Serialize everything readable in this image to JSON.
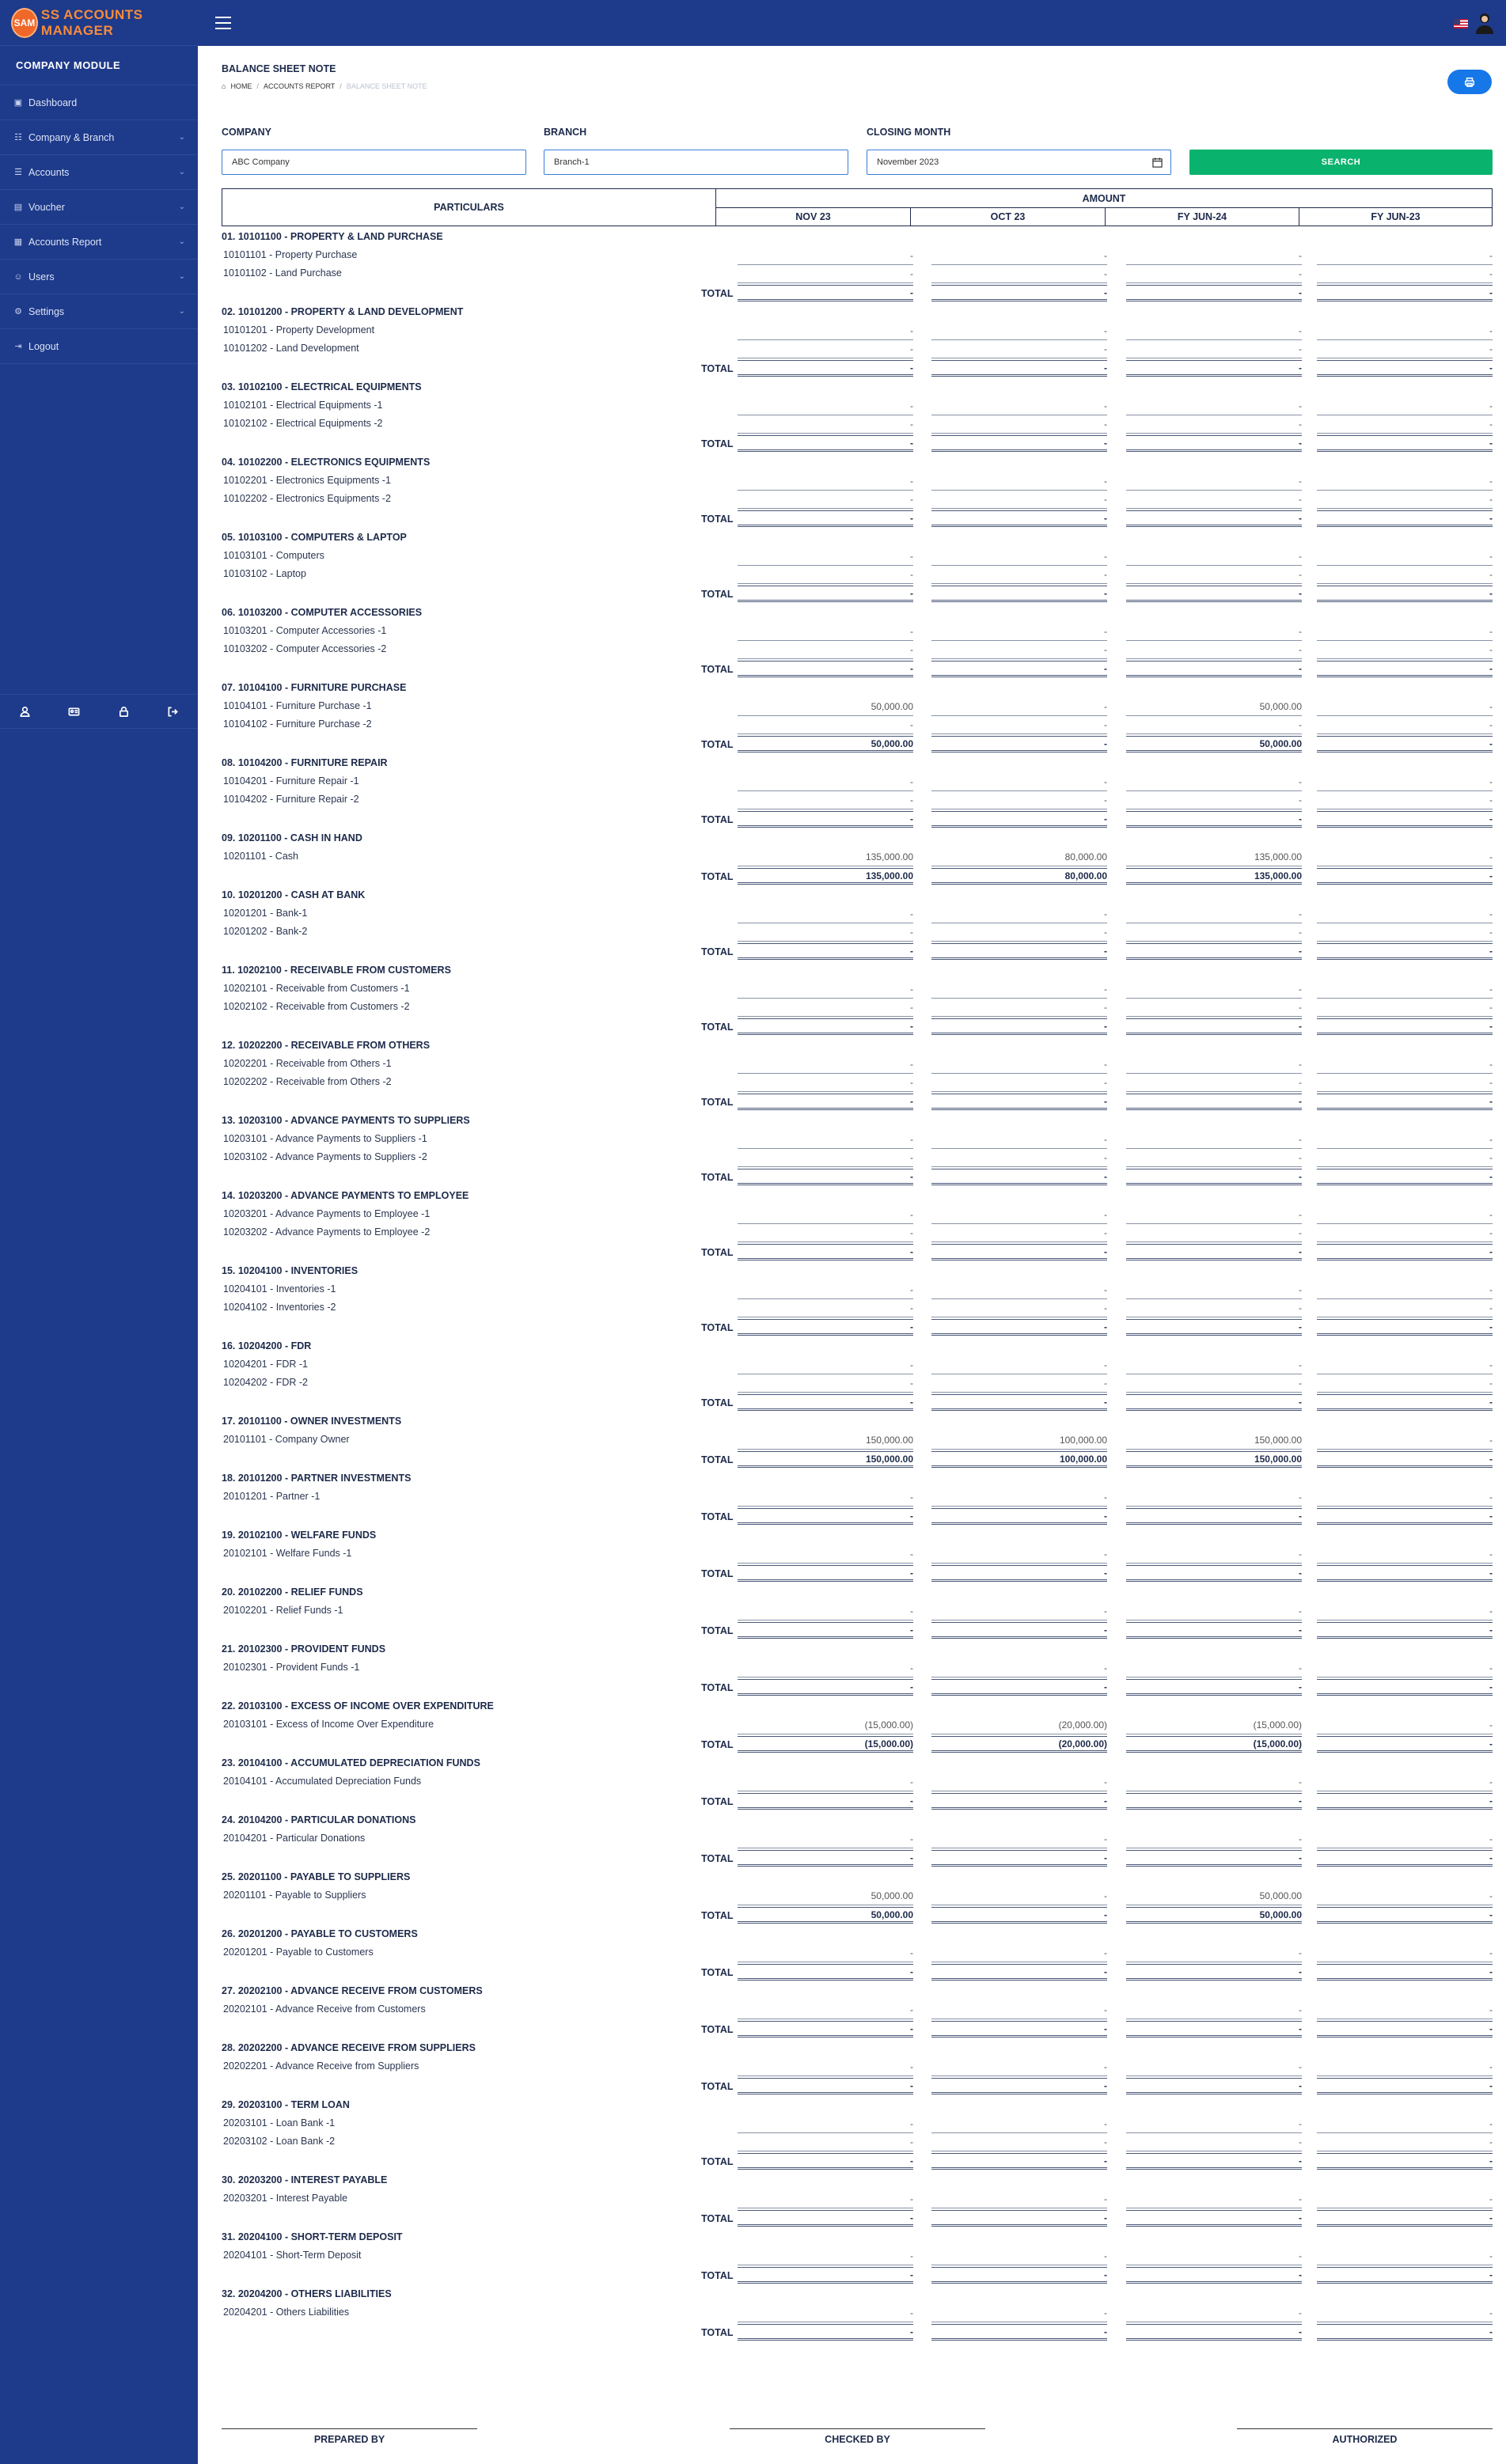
{
  "brand": {
    "logo_text": "SAM",
    "name": "SS ACCOUNTS MANAGER"
  },
  "sidebar": {
    "module_title": "COMPANY MODULE",
    "items": [
      {
        "label": "Dashboard",
        "icon": "home-icon",
        "has_children": false
      },
      {
        "label": "Company & Branch",
        "icon": "sitemap-icon",
        "has_children": true
      },
      {
        "label": "Accounts",
        "icon": "list-icon",
        "has_children": true
      },
      {
        "label": "Voucher",
        "icon": "file-icon",
        "has_children": true
      },
      {
        "label": "Accounts Report",
        "icon": "report-icon",
        "has_children": true
      },
      {
        "label": "Users",
        "icon": "user-icon",
        "has_children": true
      },
      {
        "label": "Settings",
        "icon": "gear-icon",
        "has_children": true
      },
      {
        "label": "Logout",
        "icon": "logout-icon",
        "has_children": false
      }
    ],
    "footer_icons": [
      "user-icon",
      "id-card-icon",
      "lock-icon",
      "sign-out-icon"
    ]
  },
  "topbar": {
    "menu_icon": "hamburger-icon",
    "language_flag": "us-flag-icon",
    "avatar_icon": "user-avatar-icon"
  },
  "page": {
    "title": "BALANCE SHEET NOTE",
    "breadcrumb": [
      "HOME",
      "ACCOUNTS REPORT",
      "BALANCE SHEET NOTE"
    ],
    "print_icon": "print-icon"
  },
  "filters": {
    "company_label": "COMPANY",
    "company_value": "ABC Company",
    "branch_label": "BRANCH",
    "branch_value": "Branch-1",
    "month_label": "CLOSING MONTH",
    "month_value": "November 2023",
    "search_label": "SEARCH"
  },
  "table": {
    "particulars_header": "PARTICULARS",
    "amount_header": "AMOUNT",
    "columns": [
      "NOV 23",
      "OCT 23",
      "FY JUN-24",
      "FY JUN-23"
    ],
    "total_label": "TOTAL",
    "sections": [
      {
        "head": "01. 10101100 - PROPERTY & LAND PURCHASE",
        "rows": [
          {
            "name": "10101101 - Property Purchase",
            "values": [
              "-",
              "-",
              "-",
              "-"
            ]
          },
          {
            "name": "10101102 - Land Purchase",
            "values": [
              "-",
              "-",
              "-",
              "-"
            ]
          }
        ],
        "total": [
          "-",
          "-",
          "-",
          "-"
        ]
      },
      {
        "head": "02. 10101200 - PROPERTY & LAND DEVELOPMENT",
        "rows": [
          {
            "name": "10101201 - Property Development",
            "values": [
              "-",
              "-",
              "-",
              "-"
            ]
          },
          {
            "name": "10101202 - Land Development",
            "values": [
              "-",
              "-",
              "-",
              "-"
            ]
          }
        ],
        "total": [
          "-",
          "-",
          "-",
          "-"
        ]
      },
      {
        "head": "03. 10102100 - ELECTRICAL EQUIPMENTS",
        "rows": [
          {
            "name": "10102101 - Electrical Equipments -1",
            "values": [
              "-",
              "-",
              "-",
              "-"
            ]
          },
          {
            "name": "10102102 - Electrical Equipments -2",
            "values": [
              "-",
              "-",
              "-",
              "-"
            ]
          }
        ],
        "total": [
          "-",
          "-",
          "-",
          "-"
        ]
      },
      {
        "head": "04. 10102200 - ELECTRONICS EQUIPMENTS",
        "rows": [
          {
            "name": "10102201 - Electronics Equipments -1",
            "values": [
              "-",
              "-",
              "-",
              "-"
            ]
          },
          {
            "name": "10102202 - Electronics Equipments -2",
            "values": [
              "-",
              "-",
              "-",
              "-"
            ]
          }
        ],
        "total": [
          "-",
          "-",
          "-",
          "-"
        ]
      },
      {
        "head": "05. 10103100 - COMPUTERS & LAPTOP",
        "rows": [
          {
            "name": "10103101 - Computers",
            "values": [
              "-",
              "-",
              "-",
              "-"
            ]
          },
          {
            "name": "10103102 - Laptop",
            "values": [
              "-",
              "-",
              "-",
              "-"
            ]
          }
        ],
        "total": [
          "-",
          "-",
          "-",
          "-"
        ]
      },
      {
        "head": "06. 10103200 - COMPUTER ACCESSORIES",
        "rows": [
          {
            "name": "10103201 - Computer Accessories -1",
            "values": [
              "-",
              "-",
              "-",
              "-"
            ]
          },
          {
            "name": "10103202 - Computer Accessories -2",
            "values": [
              "-",
              "-",
              "-",
              "-"
            ]
          }
        ],
        "total": [
          "-",
          "-",
          "-",
          "-"
        ]
      },
      {
        "head": "07. 10104100 - FURNITURE PURCHASE",
        "rows": [
          {
            "name": "10104101 - Furniture Purchase -1",
            "values": [
              "50,000.00",
              "-",
              "50,000.00",
              "-"
            ]
          },
          {
            "name": "10104102 - Furniture Purchase -2",
            "values": [
              "-",
              "-",
              "-",
              "-"
            ]
          }
        ],
        "total": [
          "50,000.00",
          "-",
          "50,000.00",
          "-"
        ]
      },
      {
        "head": "08. 10104200 - FURNITURE REPAIR",
        "rows": [
          {
            "name": "10104201 - Furniture Repair -1",
            "values": [
              "-",
              "-",
              "-",
              "-"
            ]
          },
          {
            "name": "10104202 - Furniture Repair -2",
            "values": [
              "-",
              "-",
              "-",
              "-"
            ]
          }
        ],
        "total": [
          "-",
          "-",
          "-",
          "-"
        ]
      },
      {
        "head": "09. 10201100 - CASH IN HAND",
        "rows": [
          {
            "name": "10201101 - Cash",
            "values": [
              "135,000.00",
              "80,000.00",
              "135,000.00",
              "-"
            ]
          }
        ],
        "total": [
          "135,000.00",
          "80,000.00",
          "135,000.00",
          "-"
        ]
      },
      {
        "head": "10. 10201200 - CASH AT BANK",
        "rows": [
          {
            "name": "10201201 - Bank-1",
            "values": [
              "-",
              "-",
              "-",
              "-"
            ]
          },
          {
            "name": "10201202 - Bank-2",
            "values": [
              "-",
              "-",
              "-",
              "-"
            ]
          }
        ],
        "total": [
          "-",
          "-",
          "-",
          "-"
        ]
      },
      {
        "head": "11. 10202100 - RECEIVABLE FROM CUSTOMERS",
        "rows": [
          {
            "name": "10202101 - Receivable from Customers -1",
            "values": [
              "-",
              "-",
              "-",
              "-"
            ]
          },
          {
            "name": "10202102 - Receivable from Customers -2",
            "values": [
              "-",
              "-",
              "-",
              "-"
            ]
          }
        ],
        "total": [
          "-",
          "-",
          "-",
          "-"
        ]
      },
      {
        "head": "12. 10202200 - RECEIVABLE FROM OTHERS",
        "rows": [
          {
            "name": "10202201 - Receivable from Others -1",
            "values": [
              "-",
              "-",
              "-",
              "-"
            ]
          },
          {
            "name": "10202202 - Receivable from Others -2",
            "values": [
              "-",
              "-",
              "-",
              "-"
            ]
          }
        ],
        "total": [
          "-",
          "-",
          "-",
          "-"
        ]
      },
      {
        "head": "13. 10203100 - ADVANCE PAYMENTS TO SUPPLIERS",
        "rows": [
          {
            "name": "10203101 - Advance Payments to Suppliers -1",
            "values": [
              "-",
              "-",
              "-",
              "-"
            ]
          },
          {
            "name": "10203102 - Advance Payments to Suppliers -2",
            "values": [
              "-",
              "-",
              "-",
              "-"
            ]
          }
        ],
        "total": [
          "-",
          "-",
          "-",
          "-"
        ]
      },
      {
        "head": "14. 10203200 - ADVANCE PAYMENTS TO EMPLOYEE",
        "rows": [
          {
            "name": "10203201 - Advance Payments to Employee -1",
            "values": [
              "-",
              "-",
              "-",
              "-"
            ]
          },
          {
            "name": "10203202 - Advance Payments to Employee -2",
            "values": [
              "-",
              "-",
              "-",
              "-"
            ]
          }
        ],
        "total": [
          "-",
          "-",
          "-",
          "-"
        ]
      },
      {
        "head": "15. 10204100 - INVENTORIES",
        "rows": [
          {
            "name": "10204101 - Inventories -1",
            "values": [
              "-",
              "-",
              "-",
              "-"
            ]
          },
          {
            "name": "10204102 - Inventories -2",
            "values": [
              "-",
              "-",
              "-",
              "-"
            ]
          }
        ],
        "total": [
          "-",
          "-",
          "-",
          "-"
        ]
      },
      {
        "head": "16. 10204200 - FDR",
        "rows": [
          {
            "name": "10204201 - FDR -1",
            "values": [
              "-",
              "-",
              "-",
              "-"
            ]
          },
          {
            "name": "10204202 - FDR -2",
            "values": [
              "-",
              "-",
              "-",
              "-"
            ]
          }
        ],
        "total": [
          "-",
          "-",
          "-",
          "-"
        ]
      },
      {
        "head": "17. 20101100 - OWNER INVESTMENTS",
        "rows": [
          {
            "name": "20101101 - Company Owner",
            "values": [
              "150,000.00",
              "100,000.00",
              "150,000.00",
              "-"
            ]
          }
        ],
        "total": [
          "150,000.00",
          "100,000.00",
          "150,000.00",
          "-"
        ]
      },
      {
        "head": "18. 20101200 - PARTNER INVESTMENTS",
        "rows": [
          {
            "name": "20101201 - Partner -1",
            "values": [
              "-",
              "-",
              "-",
              "-"
            ]
          }
        ],
        "total": [
          "-",
          "-",
          "-",
          "-"
        ]
      },
      {
        "head": "19. 20102100 - WELFARE FUNDS",
        "rows": [
          {
            "name": "20102101 - Welfare Funds -1",
            "values": [
              "-",
              "-",
              "-",
              "-"
            ]
          }
        ],
        "total": [
          "-",
          "-",
          "-",
          "-"
        ]
      },
      {
        "head": "20. 20102200 - RELIEF FUNDS",
        "rows": [
          {
            "name": "20102201 - Relief Funds -1",
            "values": [
              "-",
              "-",
              "-",
              "-"
            ]
          }
        ],
        "total": [
          "-",
          "-",
          "-",
          "-"
        ]
      },
      {
        "head": "21. 20102300 - PROVIDENT FUNDS",
        "rows": [
          {
            "name": "20102301 - Provident Funds -1",
            "values": [
              "-",
              "-",
              "-",
              "-"
            ]
          }
        ],
        "total": [
          "-",
          "-",
          "-",
          "-"
        ]
      },
      {
        "head": "22. 20103100 - EXCESS OF INCOME OVER EXPENDITURE",
        "rows": [
          {
            "name": "20103101 - Excess of Income Over Expenditure",
            "values": [
              "(15,000.00)",
              "(20,000.00)",
              "(15,000.00)",
              "-"
            ]
          }
        ],
        "total": [
          "(15,000.00)",
          "(20,000.00)",
          "(15,000.00)",
          "-"
        ]
      },
      {
        "head": "23. 20104100 - ACCUMULATED DEPRECIATION FUNDS",
        "rows": [
          {
            "name": "20104101 - Accumulated Depreciation Funds",
            "values": [
              "-",
              "-",
              "-",
              "-"
            ]
          }
        ],
        "total": [
          "-",
          "-",
          "-",
          "-"
        ]
      },
      {
        "head": "24. 20104200 - PARTICULAR DONATIONS",
        "rows": [
          {
            "name": "20104201 - Particular Donations",
            "values": [
              "-",
              "-",
              "-",
              "-"
            ]
          }
        ],
        "total": [
          "-",
          "-",
          "-",
          "-"
        ]
      },
      {
        "head": "25. 20201100 - PAYABLE TO SUPPLIERS",
        "rows": [
          {
            "name": "20201101 - Payable to Suppliers",
            "values": [
              "50,000.00",
              "-",
              "50,000.00",
              "-"
            ]
          }
        ],
        "total": [
          "50,000.00",
          "-",
          "50,000.00",
          "-"
        ]
      },
      {
        "head": "26. 20201200 - PAYABLE TO CUSTOMERS",
        "rows": [
          {
            "name": "20201201 - Payable to Customers",
            "values": [
              "-",
              "-",
              "-",
              "-"
            ]
          }
        ],
        "total": [
          "-",
          "-",
          "-",
          "-"
        ]
      },
      {
        "head": "27. 20202100 - ADVANCE RECEIVE FROM CUSTOMERS",
        "rows": [
          {
            "name": "20202101 - Advance Receive from Customers",
            "values": [
              "-",
              "-",
              "-",
              "-"
            ]
          }
        ],
        "total": [
          "-",
          "-",
          "-",
          "-"
        ]
      },
      {
        "head": "28. 20202200 - ADVANCE RECEIVE FROM SUPPLIERS",
        "rows": [
          {
            "name": "20202201 - Advance Receive from Suppliers",
            "values": [
              "-",
              "-",
              "-",
              "-"
            ]
          }
        ],
        "total": [
          "-",
          "-",
          "-",
          "-"
        ]
      },
      {
        "head": "29. 20203100 - TERM LOAN",
        "rows": [
          {
            "name": "20203101 - Loan Bank -1",
            "values": [
              "-",
              "-",
              "-",
              "-"
            ]
          },
          {
            "name": "20203102 - Loan Bank -2",
            "values": [
              "-",
              "-",
              "-",
              "-"
            ]
          }
        ],
        "total": [
          "-",
          "-",
          "-",
          "-"
        ]
      },
      {
        "head": "30. 20203200 - INTEREST PAYABLE",
        "rows": [
          {
            "name": "20203201 - Interest Payable",
            "values": [
              "-",
              "-",
              "-",
              "-"
            ]
          }
        ],
        "total": [
          "-",
          "-",
          "-",
          "-"
        ]
      },
      {
        "head": "31. 20204100 - SHORT-TERM DEPOSIT",
        "rows": [
          {
            "name": "20204101 - Short-Term Deposit",
            "values": [
              "-",
              "-",
              "-",
              "-"
            ]
          }
        ],
        "total": [
          "-",
          "-",
          "-",
          "-"
        ]
      },
      {
        "head": "32. 20204200 - OTHERS LIABILITIES",
        "rows": [
          {
            "name": "20204201 - Others Liabilities",
            "values": [
              "-",
              "-",
              "-",
              "-"
            ]
          }
        ],
        "total": [
          "-",
          "-",
          "-",
          "-"
        ]
      }
    ]
  },
  "signatures": [
    "PREPARED BY",
    "CHECKED BY",
    "AUTHORIZED"
  ]
}
